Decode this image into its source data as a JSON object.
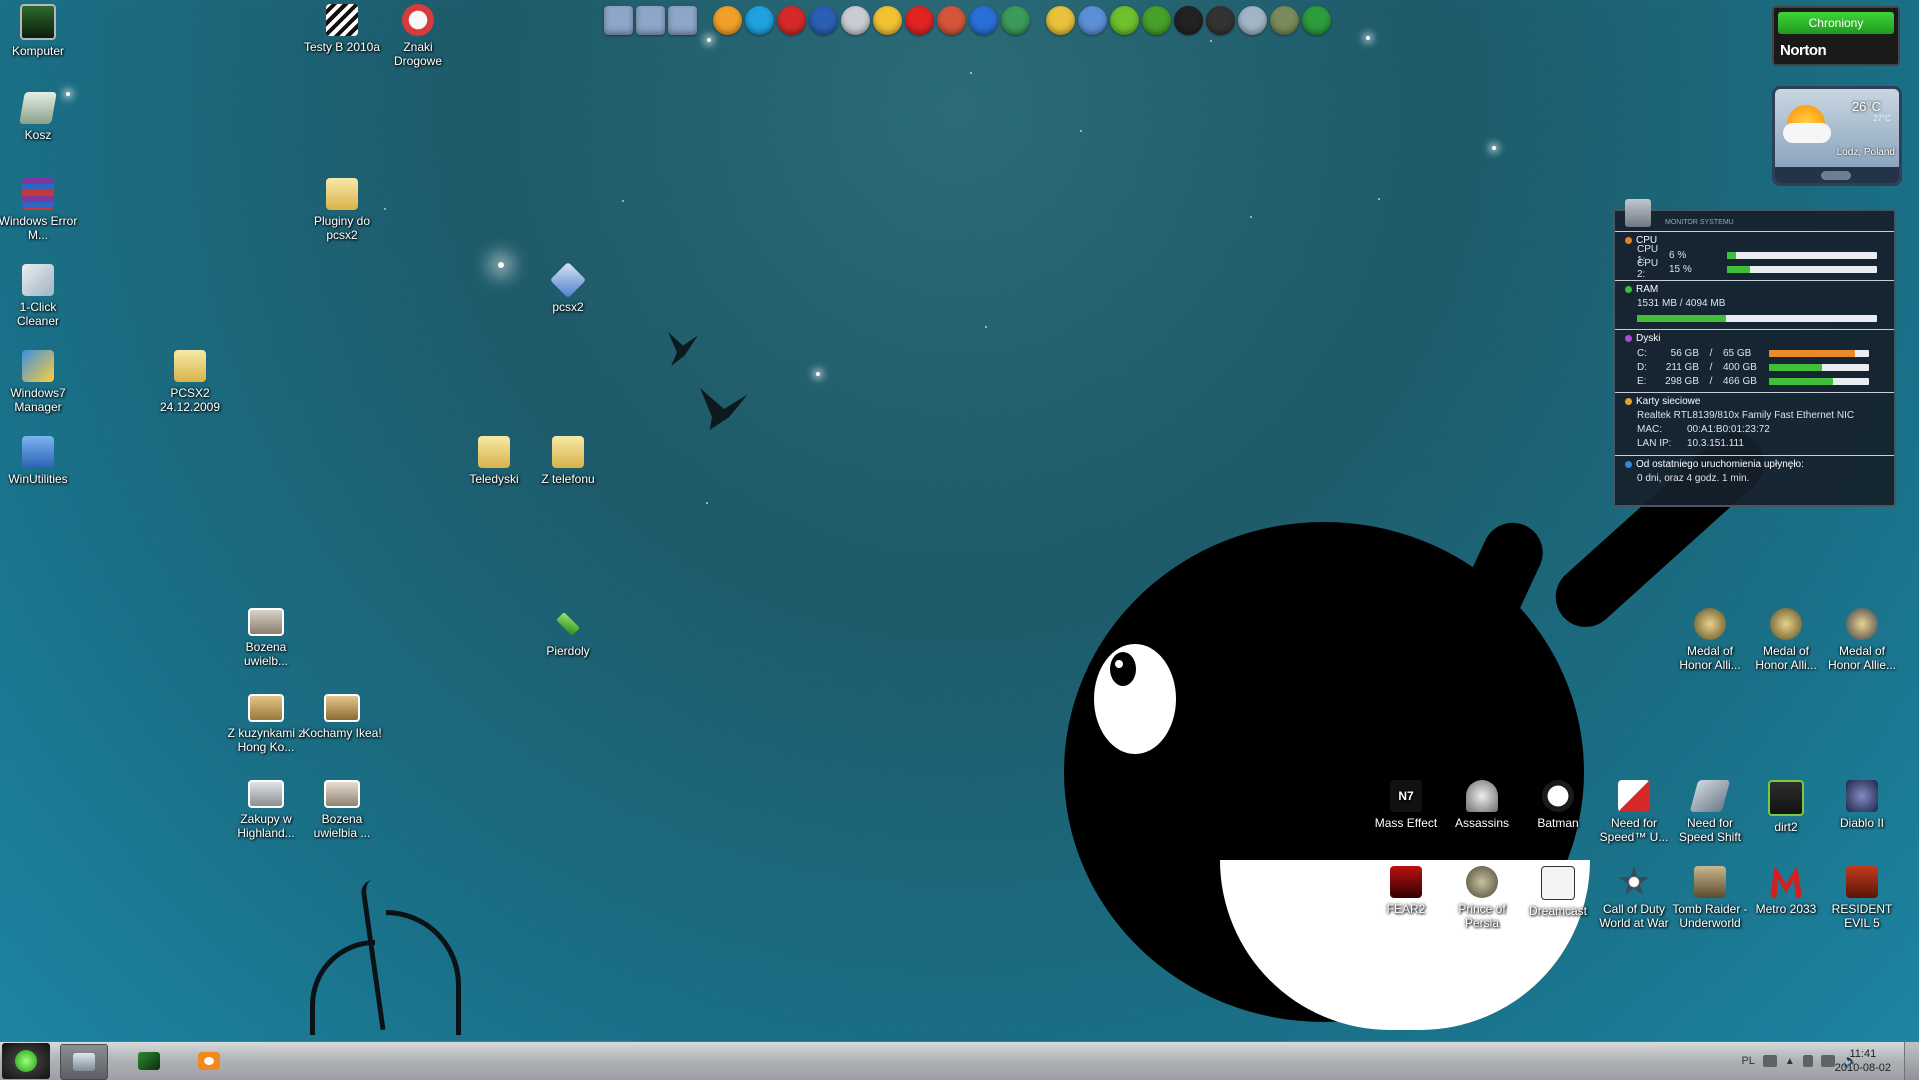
{
  "desktop": {
    "icons_left": [
      {
        "label": "Komputer",
        "icon": "computer-icon"
      },
      {
        "label": "Kosz",
        "icon": "recycle-bin-icon"
      },
      {
        "label": "Windows Error M...",
        "icon": "winrar-icon"
      },
      {
        "label": "1-Click Cleaner",
        "icon": "cleaner-icon"
      },
      {
        "label": "Windows7 Manager",
        "icon": "windows7-manager-icon"
      },
      {
        "label": "WinUtilities",
        "icon": "winutilities-icon"
      }
    ],
    "icons_top": [
      {
        "label": "Testy B 2010a",
        "icon": "testy-icon"
      },
      {
        "label": "Znaki Drogowe",
        "icon": "road-sign-icon"
      }
    ],
    "icons_mid": [
      {
        "label": "Pluginy do pcsx2",
        "icon": "folder-icon"
      },
      {
        "label": "pcsx2",
        "icon": "pcsx2-icon"
      },
      {
        "label": "PCSX2 24.12.2009",
        "icon": "folder-zip-icon"
      },
      {
        "label": "Teledyski",
        "icon": "folder-icon"
      },
      {
        "label": "Z telefonu",
        "icon": "folder-icon"
      },
      {
        "label": "Pierdoly",
        "icon": "green-diamond-icon"
      }
    ],
    "photo_icons": [
      {
        "label": "Bozena uwielb...",
        "icon": "photo-icon"
      },
      {
        "label": "Z kuzynkami z Hong Ko...",
        "icon": "photo-icon"
      },
      {
        "label": "Kochamy Ikea!",
        "icon": "photo-icon"
      },
      {
        "label": "Zakupy w Highland...",
        "icon": "photo-icon"
      },
      {
        "label": "Bozena uwielbia ...",
        "icon": "photo-icon"
      }
    ],
    "game_icons_top": [
      {
        "label": "Medal of Honor Alli...",
        "icon": "medal-icon"
      },
      {
        "label": "Medal of Honor Alli...",
        "icon": "medal-icon"
      },
      {
        "label": "Medal of Honor Allie...",
        "icon": "medal-icon"
      }
    ],
    "game_icons_row1": [
      {
        "label": "Mass Effect",
        "icon": "n7-icon"
      },
      {
        "label": "Assassins",
        "icon": "assassins-icon"
      },
      {
        "label": "Batman",
        "icon": "batman-icon"
      },
      {
        "label": "Need for Speed™ U...",
        "icon": "nfs-icon"
      },
      {
        "label": "Need for Speed Shift",
        "icon": "nfs-shift-icon"
      },
      {
        "label": "dirt2",
        "icon": "dirt2-icon"
      },
      {
        "label": "Diablo II",
        "icon": "diablo-icon"
      }
    ],
    "game_icons_row2": [
      {
        "label": "FEAR2",
        "icon": "fear2-icon"
      },
      {
        "label": "Prince of Persia",
        "icon": "prince-of-persia-icon"
      },
      {
        "label": "Dreamcast",
        "icon": "dreamcast-icon"
      },
      {
        "label": "Call of Duty World at War",
        "icon": "cod-icon"
      },
      {
        "label": "Tomb Raider - Underworld",
        "icon": "tomb-raider-icon"
      },
      {
        "label": "Metro 2033",
        "icon": "metro-icon"
      },
      {
        "label": "RESIDENT EVIL 5",
        "icon": "resident-evil-icon"
      }
    ]
  },
  "quicklaunch": [
    {
      "icon": "folder-open-icon",
      "color": "#8fa6c8"
    },
    {
      "icon": "folder-open-icon",
      "color": "#8fa6c8"
    },
    {
      "icon": "folder-open-icon",
      "color": "#8fa6c8"
    },
    {
      "icon": "smiley-icon",
      "color": "#f2a02a"
    },
    {
      "icon": "skype-icon",
      "color": "#1fa2e0"
    },
    {
      "icon": "gmail-icon",
      "color": "#d62a2a"
    },
    {
      "icon": "a-icon",
      "color": "#2b5fb4"
    },
    {
      "icon": "ink-icon",
      "color": "#c9cdd3"
    },
    {
      "icon": "lightning-icon",
      "color": "#f1c232"
    },
    {
      "icon": "power-icon",
      "color": "#e02424"
    },
    {
      "icon": "globe-icon",
      "color": "#d5553a"
    },
    {
      "icon": "flash-icon",
      "color": "#2a6fd6"
    },
    {
      "icon": "monitor-icon",
      "color": "#3c9a5a"
    },
    {
      "icon": "ii-icon",
      "color": "#e8c23a"
    },
    {
      "icon": "phone-icon",
      "color": "#5c8fd8"
    },
    {
      "icon": "ovi-icon",
      "color": "#6fbf2e"
    },
    {
      "icon": "gear-icon",
      "color": "#47a02a"
    },
    {
      "icon": "hp-icon",
      "color": "#222222"
    },
    {
      "icon": "hp-small-icon",
      "color": "#333333"
    },
    {
      "icon": "camera-icon",
      "color": "#a3b4c6"
    },
    {
      "icon": "box-icon",
      "color": "#7b8a5a"
    },
    {
      "icon": "info-icon",
      "color": "#2d9c3c"
    }
  ],
  "norton": {
    "status": "Chroniony",
    "brand": "Norton"
  },
  "weather": {
    "temp": "26°C",
    "temp_low": "27°C",
    "city": "Lodz, Poland"
  },
  "sysmon": {
    "title": "MONITOR SYSTEMU",
    "cpu": {
      "heading": "CPU",
      "rows": [
        {
          "label": "CPU 1:",
          "value": "6 %",
          "pct": 6
        },
        {
          "label": "CPU 2:",
          "value": "15 %",
          "pct": 15
        }
      ]
    },
    "ram": {
      "heading": "RAM",
      "text": "1531 MB / 4094 MB",
      "pct": 37
    },
    "disks": {
      "heading": "Dyski",
      "rows": [
        {
          "label": "C:",
          "used": "56 GB",
          "sep": "/",
          "total": "65 GB",
          "pct": 86
        },
        {
          "label": "D:",
          "used": "211 GB",
          "sep": "/",
          "total": "400 GB",
          "pct": 53
        },
        {
          "label": "E:",
          "used": "298 GB",
          "sep": "/",
          "total": "466 GB",
          "pct": 64
        }
      ]
    },
    "net": {
      "heading": "Karty sieciowe",
      "adapter": "Realtek RTL8139/810x Family Fast Ethernet NIC",
      "mac_label": "MAC:",
      "mac": "00:A1:B0:01:23:72",
      "ip_label": "LAN IP:",
      "ip": "10.3.151.111"
    },
    "uptime": {
      "heading": "Od ostatniego uruchomienia upłynęło:",
      "text": "0 dni, oraz 4 godz. 1 min."
    }
  },
  "taskbar": {
    "lang": "PL",
    "time": "11:41",
    "date": "2010-08-02",
    "buttons": [
      {
        "icon": "explorer-icon"
      },
      {
        "icon": "winrar-icon"
      },
      {
        "icon": "media-player-icon"
      }
    ]
  }
}
